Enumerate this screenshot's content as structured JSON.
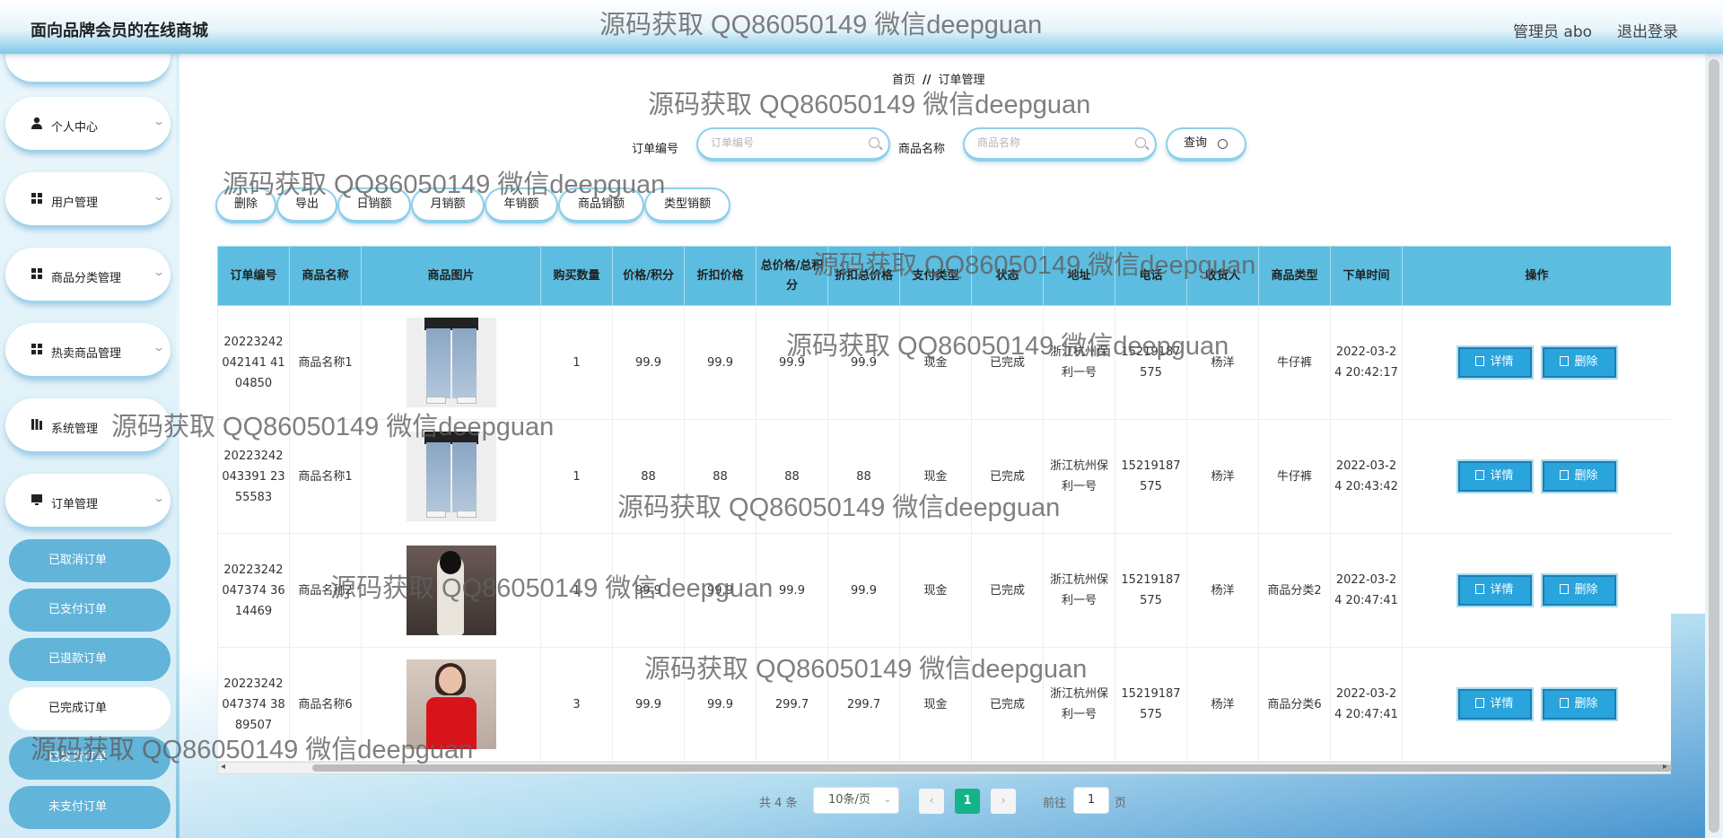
{
  "header": {
    "title": "面向品牌会员的在线商城",
    "admin": "管理员 abo",
    "logout": "退出登录"
  },
  "sidebar": {
    "items": [
      {
        "label": "个人中心",
        "icon": "user-icon"
      },
      {
        "label": "用户管理",
        "icon": "grid-icon"
      },
      {
        "label": "商品分类管理",
        "icon": "grid-icon"
      },
      {
        "label": "热卖商品管理",
        "icon": "grid-icon"
      },
      {
        "label": "系统管理",
        "icon": "bars-icon"
      },
      {
        "label": "订单管理",
        "icon": "monitor-icon"
      }
    ],
    "subitems": [
      {
        "label": "已取消订单"
      },
      {
        "label": "已支付订单"
      },
      {
        "label": "已退款订单"
      },
      {
        "label": "已完成订单",
        "active": true
      },
      {
        "label": "已发货订单"
      },
      {
        "label": "未支付订单"
      }
    ]
  },
  "breadcrumb": {
    "home": "首页",
    "sep": "//",
    "current": "订单管理"
  },
  "search": {
    "order_label": "订单编号",
    "order_placeholder": "订单编号",
    "product_label": "商品名称",
    "product_placeholder": "商品名称",
    "query": "查询"
  },
  "toolbar": {
    "delete": "删除",
    "export": "导出",
    "daily": "日销额",
    "monthly": "月销额",
    "yearly": "年销额",
    "product_sales": "商品销额",
    "type_sales": "类型销额"
  },
  "table": {
    "headers": [
      "订单编号",
      "商品名称",
      "商品图片",
      "购买数量",
      "价格/积分",
      "折扣价格",
      "总价格/总积分",
      "折扣总价格",
      "支付类型",
      "状态",
      "地址",
      "电话",
      "收货人",
      "商品类型",
      "下单时间",
      "操作"
    ],
    "rows": [
      {
        "order_no": "20223242042141 4104850",
        "name": "商品名称1",
        "qty": "1",
        "price": "99.9",
        "discount": "99.9",
        "total": "99.9",
        "discount_total": "99.9",
        "pay": "现金",
        "status": "已完成",
        "address": "浙江杭州保利一号",
        "phone": "15219187575",
        "receiver": "杨洋",
        "type": "牛仔裤",
        "time": "2022-03-24 20:42:17"
      },
      {
        "order_no": "20223242043391 2355583",
        "name": "商品名称1",
        "qty": "1",
        "price": "88",
        "discount": "88",
        "total": "88",
        "discount_total": "88",
        "pay": "现金",
        "status": "已完成",
        "address": "浙江杭州保利一号",
        "phone": "15219187575",
        "receiver": "杨洋",
        "type": "牛仔裤",
        "time": "2022-03-24 20:43:42"
      },
      {
        "order_no": "20223242047374 3614469",
        "name": "商品名称2",
        "qty": "1",
        "price": "99.9",
        "discount": "99.9",
        "total": "99.9",
        "discount_total": "99.9",
        "pay": "现金",
        "status": "已完成",
        "address": "浙江杭州保利一号",
        "phone": "15219187575",
        "receiver": "杨洋",
        "type": "商品分类2",
        "time": "2022-03-24 20:47:41"
      },
      {
        "order_no": "20223242047374 3889507",
        "name": "商品名称6",
        "qty": "3",
        "price": "99.9",
        "discount": "99.9",
        "total": "299.7",
        "discount_total": "299.7",
        "pay": "现金",
        "status": "已完成",
        "address": "浙江杭州保利一号",
        "phone": "15219187575",
        "receiver": "杨洋",
        "type": "商品分类6",
        "time": "2022-03-24 20:47:41"
      }
    ],
    "actions": {
      "detail": "详情",
      "delete": "删除"
    }
  },
  "pager": {
    "total": "共 4 条",
    "size": "10条/页",
    "current": "1",
    "goto_pre": "前往",
    "goto_value": "1",
    "goto_post": "页"
  },
  "watermark": "源码获取 QQ86050149 微信deepguan",
  "colors": {
    "header_cell": "#5cbde0",
    "action_button": "#29a4dd",
    "pager_active": "#15b38a",
    "submenu": "#62b4d9"
  }
}
